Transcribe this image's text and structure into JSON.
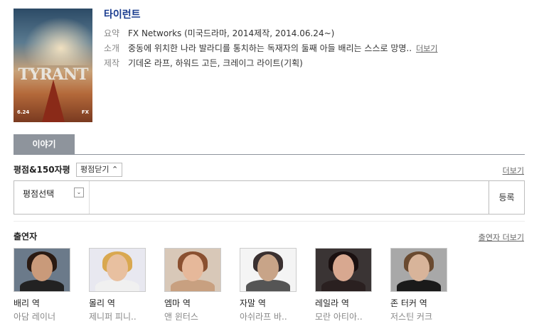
{
  "show": {
    "title": "타이런트",
    "summary_label": "요약",
    "network": "FX Networks",
    "summary_rest": " (미국드라마, 2014제작, 2014.06.24~)",
    "synopsis_label": "소개",
    "synopsis": "중동에 위치한 나라 발라디를 통치하는 독재자의 둘째 아들 배리는 스스로 망명..",
    "synopsis_more": "더보기",
    "production_label": "제작",
    "production_names": "기데온 라프, 하워드 고든, 크레이그 라이트",
    "production_role": "(기획)",
    "poster": {
      "logo_text": "TYRANT",
      "date_text": "6.24",
      "network_text": "FX"
    }
  },
  "tabs": [
    {
      "label": "이야기",
      "active": true
    }
  ],
  "rating": {
    "section_title": "평점&150자평",
    "toggle_label": "평점닫기 ⌃",
    "more_label": "더보기",
    "select_label": "평점선택",
    "select_arrow": "⌄",
    "register_label": "등록"
  },
  "cast": {
    "section_title": "출연자",
    "more_label": "출연자 더보기",
    "members": [
      {
        "role": "배리 역",
        "actor": "아담 레이너",
        "skin": "#c99a7a",
        "hair": "#2a1a12",
        "cloth": "#222222",
        "bg": "#6b7a8a"
      },
      {
        "role": "몰리 역",
        "actor": "제니퍼 피니..",
        "skin": "#e8c0a0",
        "hair": "#d9a850",
        "cloth": "#f0f0f0",
        "bg": "#e8e8f0"
      },
      {
        "role": "엠마 역",
        "actor": "앤 윈터스",
        "skin": "#e6b89a",
        "hair": "#8a5030",
        "cloth": "#c8a080",
        "bg": "#d8c8b8"
      },
      {
        "role": "자말 역",
        "actor": "아쉬라프 바..",
        "skin": "#c8a488",
        "hair": "#3a3030",
        "cloth": "#555555",
        "bg": "#f4f4f4"
      },
      {
        "role": "레일라 역",
        "actor": "모란 아티아..",
        "skin": "#d8a890",
        "hair": "#1a1010",
        "cloth": "#2a2020",
        "bg": "#3a3434"
      },
      {
        "role": "존 터커 역",
        "actor": "저스틴 커크",
        "skin": "#d8b49a",
        "hair": "#6a4a30",
        "cloth": "#1a1a1a",
        "bg": "#a8a8a8"
      }
    ]
  }
}
